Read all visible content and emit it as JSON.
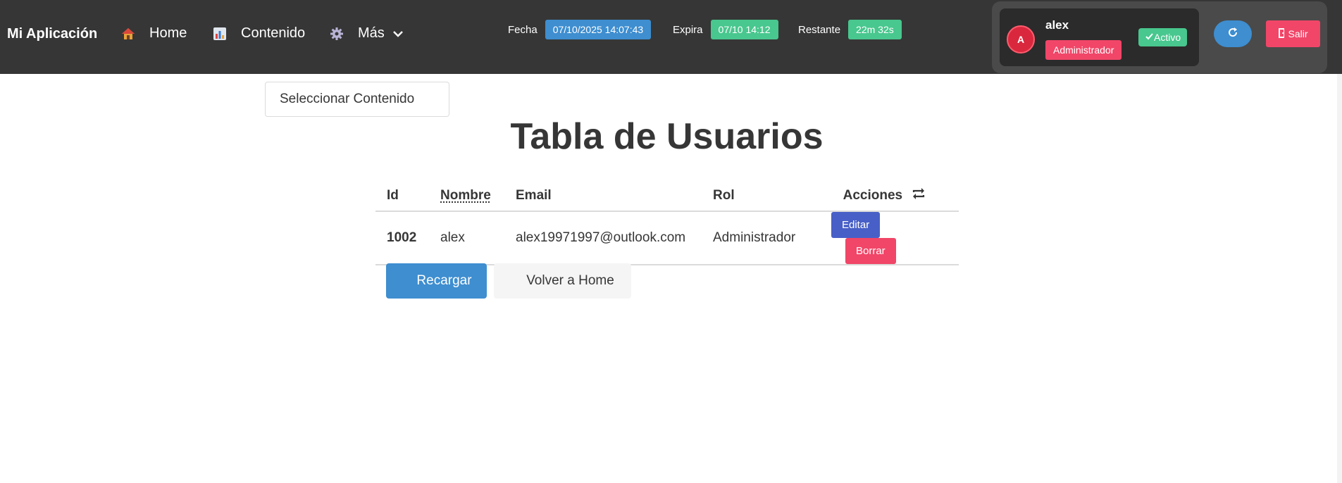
{
  "navbar": {
    "brand": "Mi Aplicación",
    "home_label": "Home",
    "content_label": "Contenido",
    "more_label": "Más"
  },
  "session": {
    "date_label": "Fecha",
    "date_value": "07/10/2025 14:07:43",
    "expires_label": "Expira",
    "expires_value": "07/10 14:12",
    "remaining_label": "Restante",
    "remaining_value": "22m 32s"
  },
  "user": {
    "initial": "A",
    "name": "alex",
    "role": "Administrador",
    "status": "Activo",
    "logout_label": "Salir"
  },
  "content": {
    "select_placeholder": "Seleccionar Contenido",
    "title": "Tabla de Usuarios"
  },
  "table": {
    "headers": {
      "id": "Id",
      "name": "Nombre",
      "email": "Email",
      "role": "Rol",
      "actions": "Acciones"
    },
    "rows": [
      {
        "id": "1002",
        "name": "alex",
        "email": "alex19971997@outlook.com",
        "role": "Administrador",
        "edit_label": "Editar",
        "delete_label": "Borrar"
      }
    ]
  },
  "buttons": {
    "reload": "Recargar",
    "back_home": "Volver a Home"
  },
  "colors": {
    "navbar": "#363636",
    "info": "#3e8ed0",
    "success": "#48c78e",
    "danger": "#f14668",
    "link": "#485fc7"
  }
}
